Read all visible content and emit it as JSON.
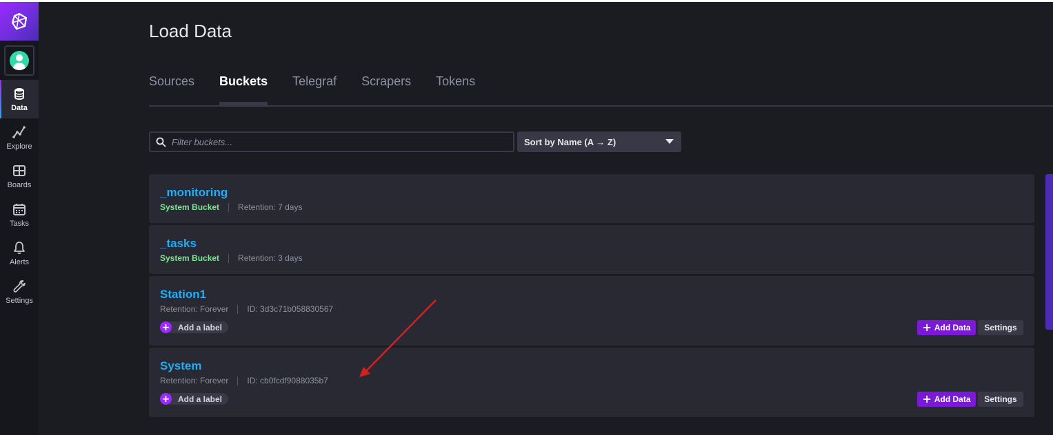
{
  "sidebar": {
    "items": [
      {
        "label": "Data",
        "icon": "database-icon",
        "active": true
      },
      {
        "label": "Explore",
        "icon": "graph-line-icon",
        "active": false
      },
      {
        "label": "Boards",
        "icon": "dashboard-grid-icon",
        "active": false
      },
      {
        "label": "Tasks",
        "icon": "calendar-icon",
        "active": false
      },
      {
        "label": "Alerts",
        "icon": "bell-icon",
        "active": false
      },
      {
        "label": "Settings",
        "icon": "wrench-icon",
        "active": false
      }
    ]
  },
  "header": {
    "title": "Load Data"
  },
  "tabs": [
    {
      "label": "Sources",
      "active": false
    },
    {
      "label": "Buckets",
      "active": true
    },
    {
      "label": "Telegraf",
      "active": false
    },
    {
      "label": "Scrapers",
      "active": false
    },
    {
      "label": "Tokens",
      "active": false
    }
  ],
  "filter": {
    "placeholder": "Filter buckets...",
    "value": ""
  },
  "sort": {
    "selected": "Sort by Name (A → Z)"
  },
  "buckets": [
    {
      "name": "_monitoring",
      "type": "System Bucket",
      "retention": "Retention: 7 days"
    },
    {
      "name": "_tasks",
      "type": "System Bucket",
      "retention": "Retention: 3 days"
    },
    {
      "name": "Station1",
      "retention": "Retention: Forever",
      "id": "ID: 3d3c71b058830567",
      "add_label": "Add a label",
      "add_data": "Add Data",
      "settings": "Settings"
    },
    {
      "name": "System",
      "retention": "Retention: Forever",
      "id": "ID: cb0fcdf9088035b7",
      "add_label": "Add a label",
      "add_data": "Add Data",
      "settings": "Settings"
    }
  ],
  "colors": {
    "background": "#1b1b22",
    "panel": "#292933",
    "accent_purple": "#9b2aff",
    "link_blue": "#22adf6",
    "system_green": "#7ce490",
    "annotation_arrow": "#d42020"
  }
}
